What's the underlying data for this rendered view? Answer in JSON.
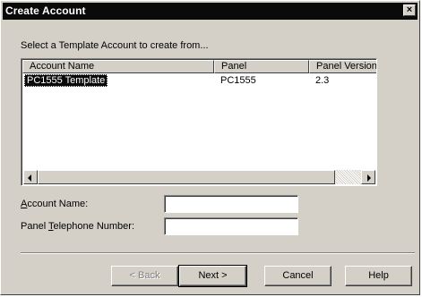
{
  "window": {
    "title": "Create Account",
    "close_glyph": "×"
  },
  "prompt": "Select a Template Account to create from...",
  "template_list": {
    "columns": [
      "Account Name",
      "Panel",
      "Panel Version"
    ],
    "rows": [
      {
        "account_name": "PC1555 Template",
        "panel": "PC1555",
        "panel_version": "2.3",
        "selected": true
      }
    ]
  },
  "form": {
    "account_name": {
      "label": "Account Name:",
      "access_key": "A",
      "value": ""
    },
    "panel_telephone": {
      "label": "Panel Telephone Number:",
      "access_key": "T",
      "value": ""
    }
  },
  "buttons": {
    "back": {
      "label": "< Back",
      "enabled": false
    },
    "next": {
      "label": "Next >",
      "default": true
    },
    "cancel": {
      "label": "Cancel"
    },
    "help": {
      "label": "Help"
    }
  },
  "colors": {
    "face": "#d4d0c8",
    "title_bar": "#0a0a0a",
    "selection": "#0a0a0a",
    "disabled_text": "#808080"
  },
  "icons": [
    "close-icon",
    "scroll-left-arrow-icon",
    "scroll-right-arrow-icon"
  ]
}
